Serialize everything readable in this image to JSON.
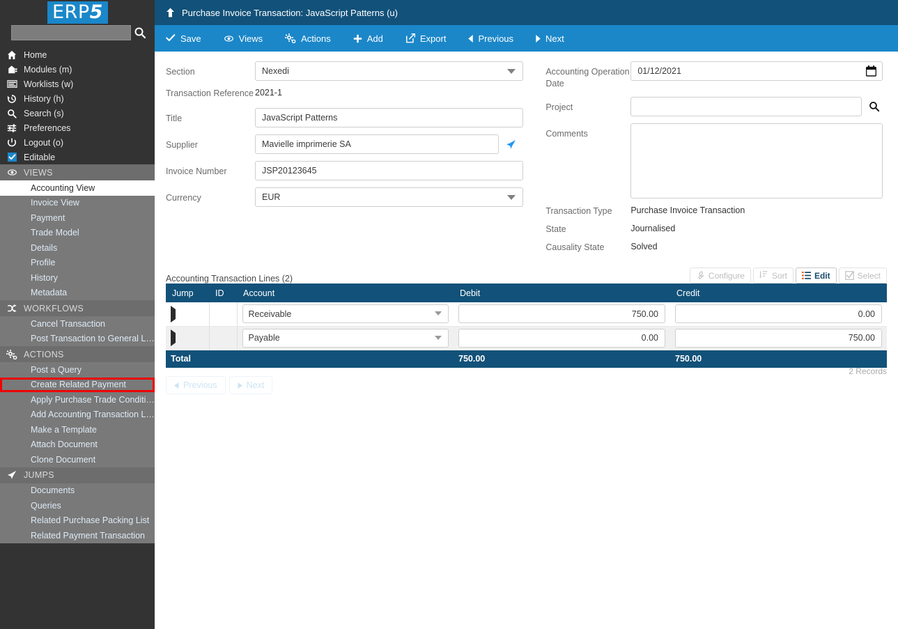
{
  "brand": {
    "logo_text_main": "ERP",
    "logo_text_accent": "5",
    "logo_bg": "#1b87c9"
  },
  "sidebar": {
    "search_placeholder": "",
    "search_value": "",
    "nav": [
      {
        "icon": "home-icon",
        "label": "Home"
      },
      {
        "icon": "modules-icon",
        "label": "Modules (m)"
      },
      {
        "icon": "worklists-icon",
        "label": "Worklists (w)"
      },
      {
        "icon": "history-icon",
        "label": "History (h)"
      },
      {
        "icon": "search-icon",
        "label": "Search (s)"
      },
      {
        "icon": "preferences-icon",
        "label": "Preferences"
      },
      {
        "icon": "logout-icon",
        "label": "Logout (o)"
      },
      {
        "icon": "checkbox-checked-icon",
        "label": "Editable"
      }
    ],
    "sections": [
      {
        "icon": "eye-icon",
        "title": "VIEWS",
        "items": [
          {
            "label": "Accounting View",
            "active": true
          },
          {
            "label": "Invoice View",
            "active": false
          },
          {
            "label": "Payment",
            "active": false
          },
          {
            "label": "Trade Model",
            "active": false
          },
          {
            "label": "Details",
            "active": false
          },
          {
            "label": "Profile",
            "active": false
          },
          {
            "label": "History",
            "active": false
          },
          {
            "label": "Metadata",
            "active": false
          }
        ]
      },
      {
        "icon": "workflows-icon",
        "title": "WORKFLOWS",
        "items": [
          {
            "label": "Cancel Transaction",
            "active": false
          },
          {
            "label": "Post Transaction to General L…",
            "active": false
          }
        ]
      },
      {
        "icon": "actions-icon",
        "title": "ACTIONS",
        "items": [
          {
            "label": "Post a Query",
            "active": false
          },
          {
            "label": "Create Related Payment",
            "active": false,
            "highlighted": true
          },
          {
            "label": "Apply Purchase Trade Conditi…",
            "active": false
          },
          {
            "label": "Add Accounting Transaction L…",
            "active": false
          },
          {
            "label": "Make a Template",
            "active": false
          },
          {
            "label": "Attach Document",
            "active": false
          },
          {
            "label": "Clone Document",
            "active": false
          }
        ]
      },
      {
        "icon": "jumps-icon",
        "title": "JUMPS",
        "items": [
          {
            "label": "Documents",
            "active": false
          },
          {
            "label": "Queries",
            "active": false
          },
          {
            "label": "Related Purchase Packing List",
            "active": false
          },
          {
            "label": "Related Payment Transaction",
            "active": false
          }
        ]
      }
    ],
    "highlight_color": "#ee0000"
  },
  "header": {
    "up_icon": "up-arrow-icon",
    "title": "Purchase Invoice Transaction: JavaScript Patterns (u)",
    "bg": "#125179"
  },
  "toolbar": {
    "bg": "#1b87c9",
    "buttons": [
      {
        "icon": "check-icon",
        "label": "Save"
      },
      {
        "icon": "eye-icon",
        "label": "Views"
      },
      {
        "icon": "gear-icon",
        "label": "Actions"
      },
      {
        "icon": "plus-icon",
        "label": "Add"
      },
      {
        "icon": "export-icon",
        "label": "Export"
      },
      {
        "icon": "previous-icon",
        "label": "Previous"
      },
      {
        "icon": "next-icon",
        "label": "Next"
      }
    ]
  },
  "form": {
    "left": {
      "section_label": "Section",
      "section_value": "Nexedi",
      "transaction_reference_label": "Transaction Reference",
      "transaction_reference_value": "2021-1",
      "title_label": "Title",
      "title_value": "JavaScript Patterns",
      "supplier_label": "Supplier",
      "supplier_value": "Mavielle imprimerie SA",
      "supplier_jump_icon": "plane-icon",
      "invoice_number_label": "Invoice Number",
      "invoice_number_value": "JSP20123645",
      "currency_label": "Currency",
      "currency_value": "EUR"
    },
    "right": {
      "date_label": "Accounting Operation Date",
      "date_value": "01/12/2021",
      "date_icon": "calendar-icon",
      "project_label": "Project",
      "project_value": "",
      "project_icon": "search-icon",
      "comments_label": "Comments",
      "comments_value": "",
      "transaction_type_label": "Transaction Type",
      "transaction_type_value": "Purchase Invoice Transaction",
      "state_label": "State",
      "state_value": "Journalised",
      "causality_state_label": "Causality State",
      "causality_state_value": "Solved"
    }
  },
  "listbox": {
    "title": "Accounting Transaction Lines (2)",
    "buttons": [
      {
        "icon": "wrench-icon",
        "label": "Configure",
        "active": false
      },
      {
        "icon": "sort-icon",
        "label": "Sort",
        "active": false
      },
      {
        "icon": "edit-list-icon",
        "label": "Edit",
        "active": true
      },
      {
        "icon": "select-icon",
        "label": "Select",
        "active": false
      }
    ],
    "columns": [
      "Jump",
      "ID",
      "Account",
      "Debit",
      "Credit"
    ],
    "rows": [
      {
        "jump": "jump-arrow-icon",
        "id": "",
        "account": "Receivable",
        "debit": "750.00",
        "credit": "0.00"
      },
      {
        "jump": "jump-arrow-icon",
        "id": "",
        "account": "Payable",
        "debit": "0.00",
        "credit": "750.00"
      }
    ],
    "total_label": "Total",
    "total_debit": "750.00",
    "total_credit": "750.00",
    "previous_label": "Previous",
    "next_label": "Next",
    "records_label": "2 Records"
  }
}
